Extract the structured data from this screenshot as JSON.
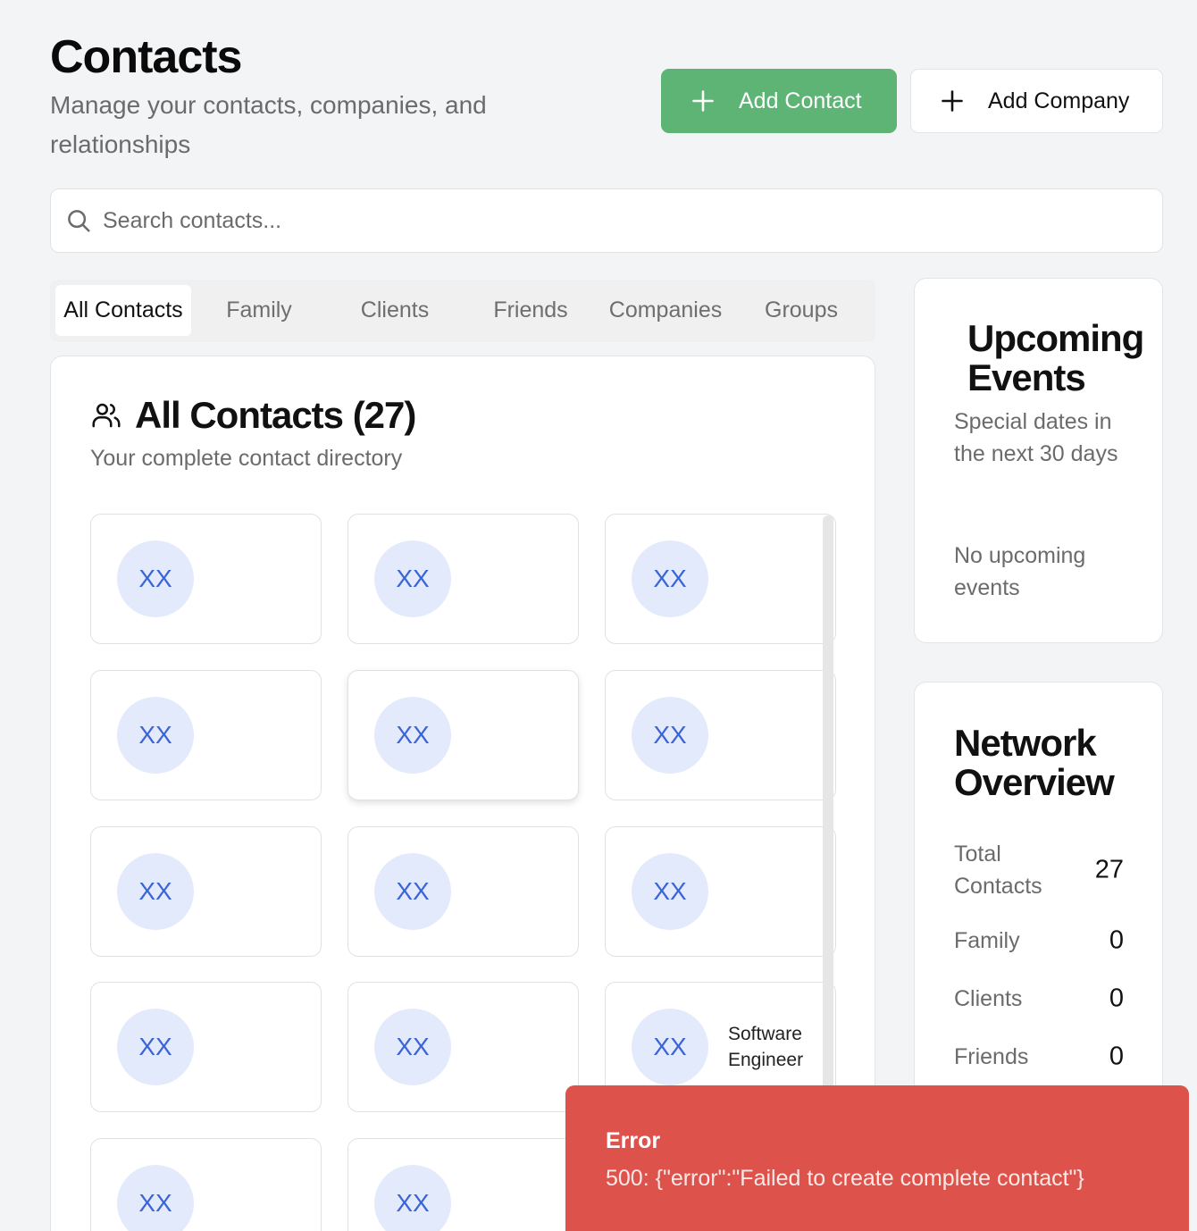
{
  "header": {
    "title": "Contacts",
    "subtitle": "Manage your contacts, companies, and relationships",
    "add_contact_label": "Add Contact",
    "add_company_label": "Add Company",
    "plus_icon": "plus-icon"
  },
  "search": {
    "placeholder": "Search contacts...",
    "value": "",
    "icon": "search-icon"
  },
  "tabs": [
    {
      "label": "All Contacts",
      "active": true
    },
    {
      "label": "Family",
      "active": false
    },
    {
      "label": "Clients",
      "active": false
    },
    {
      "label": "Friends",
      "active": false
    },
    {
      "label": "Companies",
      "active": false
    },
    {
      "label": "Groups",
      "active": false
    }
  ],
  "contacts_panel": {
    "icon": "users-icon",
    "title": "All Contacts (27)",
    "subtitle": "Your complete contact directory",
    "cards": [
      {
        "initials": "XX",
        "role": ""
      },
      {
        "initials": "XX",
        "role": ""
      },
      {
        "initials": "XX",
        "role": ""
      },
      {
        "initials": "XX",
        "role": ""
      },
      {
        "initials": "XX",
        "role": ""
      },
      {
        "initials": "XX",
        "role": ""
      },
      {
        "initials": "XX",
        "role": ""
      },
      {
        "initials": "XX",
        "role": ""
      },
      {
        "initials": "XX",
        "role": ""
      },
      {
        "initials": "XX",
        "role": ""
      },
      {
        "initials": "XX",
        "role": ""
      },
      {
        "initials": "XX",
        "role": "Software Engineer"
      },
      {
        "initials": "XX",
        "role": ""
      },
      {
        "initials": "XX",
        "role": ""
      }
    ]
  },
  "events": {
    "title": "Upcoming Events",
    "subtitle": "Special dates in the next 30 days",
    "empty": "No upcoming events"
  },
  "network": {
    "title": "Network Overview",
    "stats": [
      {
        "label": "Total Contacts",
        "value": "27"
      },
      {
        "label": "Family",
        "value": "0"
      },
      {
        "label": "Clients",
        "value": "0"
      },
      {
        "label": "Friends",
        "value": "0"
      }
    ]
  },
  "toast": {
    "title": "Error",
    "message": "500: {\"error\":\"Failed to create complete contact\"}"
  },
  "colors": {
    "primary_green": "#5db474",
    "error_red": "#de524c",
    "avatar_bg": "#e2eafb",
    "avatar_text": "#3b64d8"
  }
}
